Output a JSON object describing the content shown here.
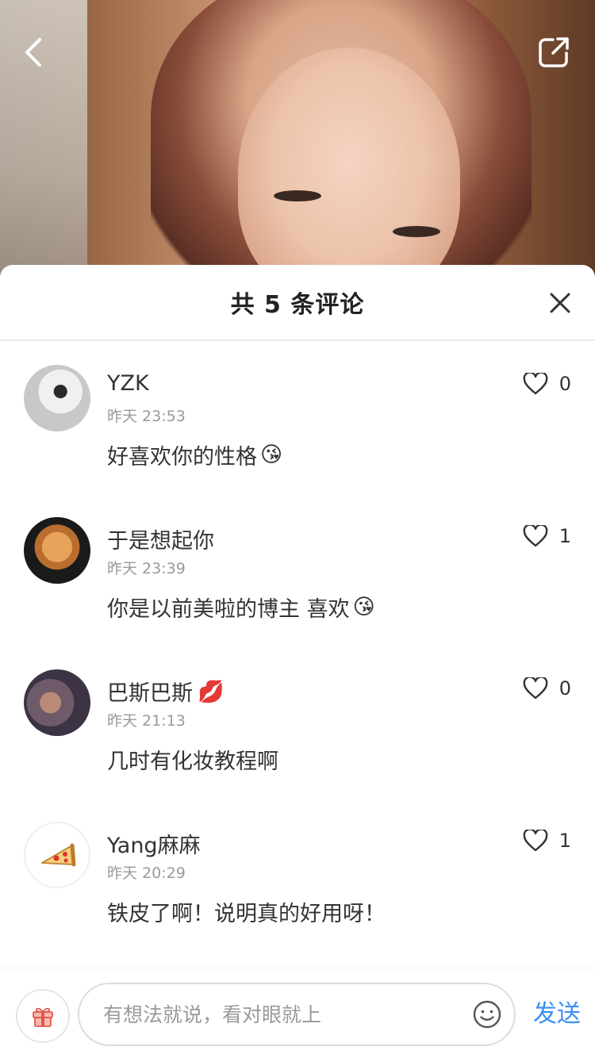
{
  "header": {
    "title": "共 5 条评论"
  },
  "comments": [
    {
      "name": "YZK",
      "time": "昨天 23:53",
      "text": "好喜欢你的性格",
      "emoji": "😘",
      "likes": "0"
    },
    {
      "name": "于是想起你",
      "time": "昨天 23:39",
      "text": "你是以前美啦的博主 喜欢",
      "emoji": "😘",
      "likes": "1"
    },
    {
      "name": "巴斯巴斯",
      "name_emoji": "💋",
      "time": "昨天 21:13",
      "text": "几时有化妆教程啊",
      "likes": "0"
    },
    {
      "name": "Yang麻麻",
      "time": "昨天 20:29",
      "text": "铁皮了啊！说明真的好用呀！",
      "likes": "1"
    }
  ],
  "input": {
    "placeholder": "有想法就说，看对眼就上",
    "send_label": "发送"
  },
  "icons": {
    "back": "chevron-left-icon",
    "share": "share-icon",
    "close": "close-icon",
    "like": "heart-icon",
    "gift": "gift-icon",
    "emoji": "smiley-icon",
    "pizza": "pizza-icon"
  },
  "colors": {
    "accent": "#3b8ff5",
    "text": "#333333",
    "muted": "#999999"
  }
}
